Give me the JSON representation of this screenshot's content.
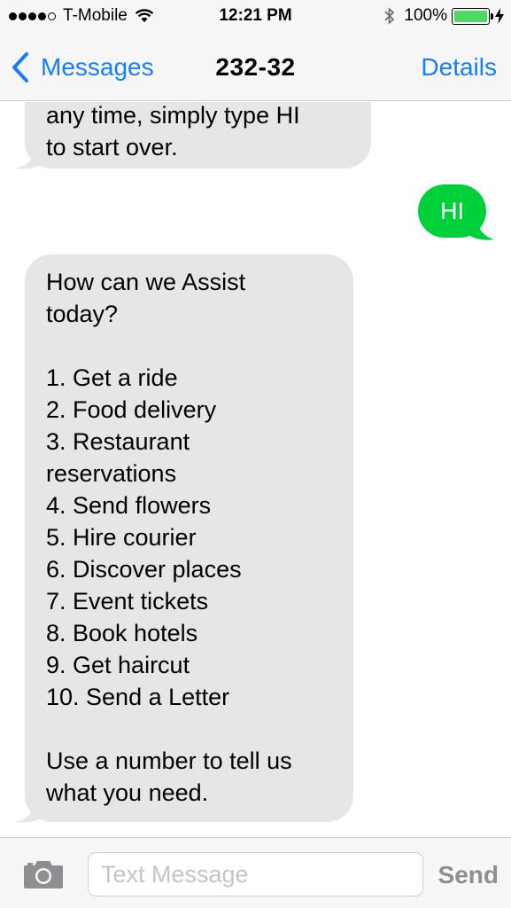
{
  "status_bar": {
    "carrier": "T-Mobile",
    "time": "12:21 PM",
    "battery_percent": "100%",
    "battery_level": 1.0,
    "signal_bars_filled": 4,
    "signal_bars_total": 5
  },
  "nav": {
    "back_label": "Messages",
    "title": "232-32",
    "details_label": "Details"
  },
  "messages": [
    {
      "direction": "incoming",
      "lines": [
        "any time, simply type HI",
        "to start over."
      ]
    },
    {
      "direction": "outgoing",
      "text": "HI"
    },
    {
      "direction": "incoming",
      "lines": [
        "How can we Assist",
        "today?",
        "",
        "1. Get a ride",
        "2. Food delivery",
        "3. Restaurant",
        "reservations",
        "4. Send flowers",
        "5. Hire courier",
        "6. Discover places",
        "7. Event tickets",
        "8. Book hotels",
        "9. Get haircut",
        "10. Send a Letter",
        "",
        "Use a number to tell us",
        "what you need."
      ]
    }
  ],
  "input": {
    "placeholder": "Text Message",
    "value": "",
    "send_label": "Send"
  },
  "colors": {
    "accent": "#147efb",
    "outgoing_bubble": "#00d13b",
    "incoming_bubble": "#e5e5ea",
    "battery": "#4cd964"
  },
  "icons": [
    "wifi-icon",
    "bluetooth-icon",
    "battery-icon",
    "charging-bolt-icon",
    "back-chevron-icon",
    "camera-icon"
  ]
}
